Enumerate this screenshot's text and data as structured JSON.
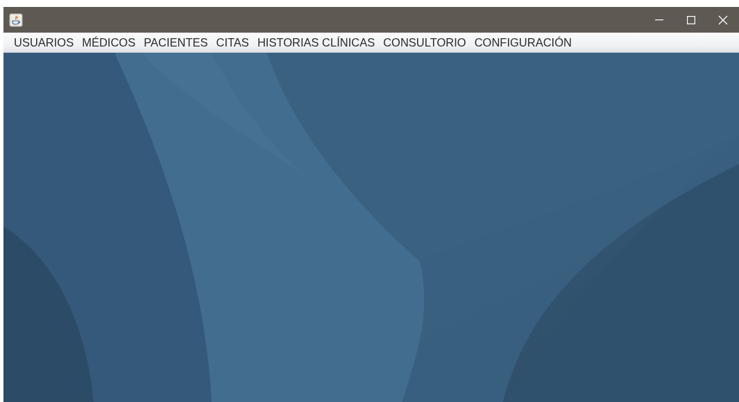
{
  "menu_bar": {
    "items": [
      {
        "label": "USUARIOS"
      },
      {
        "label": "MÉDICOS"
      },
      {
        "label": "PACIENTES"
      },
      {
        "label": "CITAS"
      },
      {
        "label": "HISTORIAS CLÍNICAS"
      },
      {
        "label": "CONSULTORIO"
      },
      {
        "label": "CONFIGURACIÓN"
      }
    ]
  }
}
